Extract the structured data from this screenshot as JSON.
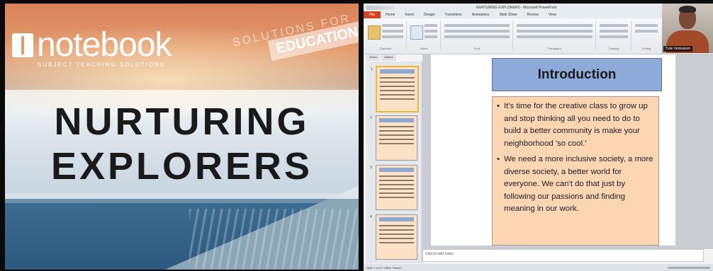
{
  "title_card": {
    "logo_text": "notebook",
    "tagline": "SUBJECT TEACHING SOLUTIONS",
    "edu_faded": "SOLUTIONS FOR",
    "edu_tag": "EDUCATION",
    "title_line1": "NURTURING",
    "title_line2": "EXPLORERS"
  },
  "powerpoint": {
    "window_title": "NURTURING EXPLORERS - Microsoft PowerPoint",
    "tabs": [
      "File",
      "Home",
      "Insert",
      "Design",
      "Transitions",
      "Animations",
      "Slide Show",
      "Review",
      "View"
    ],
    "ribbon_groups": [
      "Clipboard",
      "Slides",
      "Font",
      "Paragraph",
      "Drawing",
      "Editing"
    ],
    "pane_tabs": [
      "Slides",
      "Outline"
    ],
    "slide_numbers": [
      "1",
      "2",
      "3",
      "4"
    ],
    "slide": {
      "heading": "Introduction",
      "bullets": [
        "It's time for the creative class to grow up and stop thinking all you need to do to build a better community is make your neighborhood 'so cool.'",
        "We need a more inclusive society, a more diverse society, a better world for everyone. We can't do that just by following our passions and finding meaning in our work."
      ]
    },
    "notes_placeholder": "Click to add notes",
    "status_text": "Slide 1 of 13    \"Office Theme\"",
    "webcam_name": "Tulsi Venkatesh"
  }
}
